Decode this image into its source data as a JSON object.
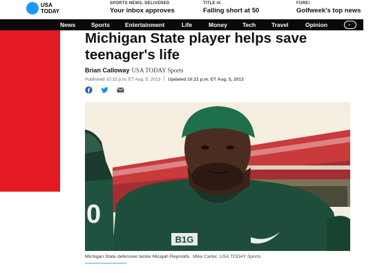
{
  "brand": {
    "logo_text": "USA TODAY",
    "accent": "#1a98ff"
  },
  "promos": [
    {
      "kicker": "SPORTS NEWS, DELIVERED",
      "headline": "Your inbox approves"
    },
    {
      "kicker": "TITLE IX",
      "headline": "Falling short at 50"
    },
    {
      "kicker": "FORE!",
      "headline": "Golfweek's top news"
    }
  ],
  "nav": {
    "items": [
      "News",
      "Sports",
      "Entertainment",
      "Life",
      "Money",
      "Tech",
      "Travel",
      "Opinion"
    ],
    "more_icon": "chevron-down-icon"
  },
  "article": {
    "title": "Michigan State player helps save teenager's life",
    "author": "Brian Calloway",
    "outlet": "USA TODAY Sports",
    "published": "Published 10:15 p.m. ET Aug. 5, 2013",
    "updated": "Updated 10:21 p.m. ET Aug. 5, 2013",
    "share_icons": [
      "facebook-icon",
      "twitter-icon",
      "email-icon"
    ],
    "photo": {
      "jersey_logo": "B1G",
      "jersey_number": "0",
      "colors": {
        "jersey": "#1e4d3b",
        "sky": "#f3eee0"
      }
    },
    "caption": "Michigan State defensive tackle Micajah Reynolds.",
    "credit": "Mike Carter, USA TODAY Sports"
  },
  "colors": {
    "left_block": "#e41a22",
    "nav_bg": "#0a0a0a",
    "share_blue": "#1a5fa8"
  }
}
